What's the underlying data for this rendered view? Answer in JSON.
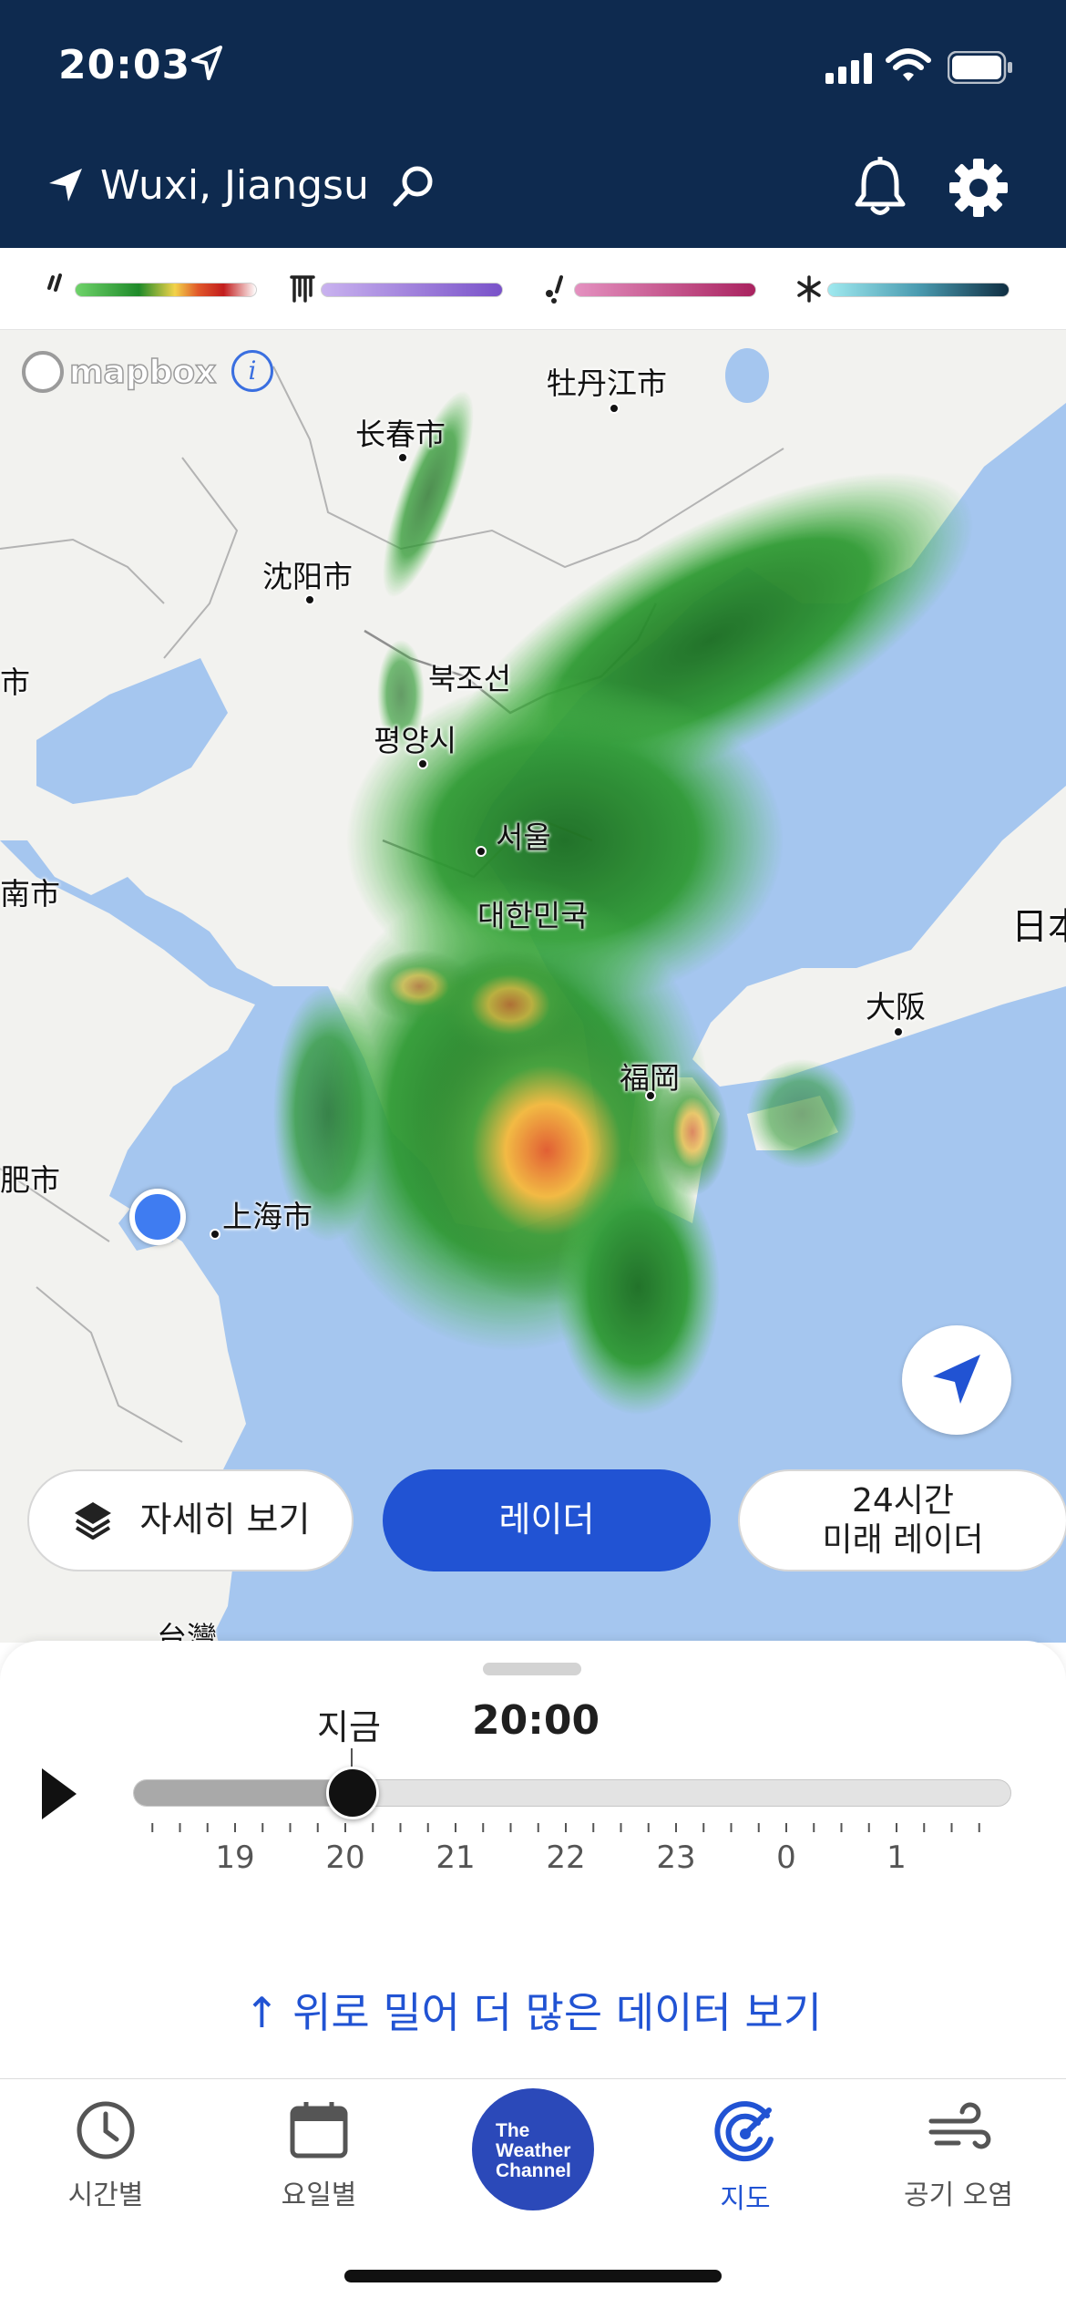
{
  "status_bar": {
    "time": "20:03"
  },
  "header": {
    "location": "Wuxi, Jiangsu"
  },
  "legend": {
    "items": [
      {
        "icon": "rain-icon",
        "gradient": [
          "#6fd36a",
          "#1f8a2a",
          "#f2d34a",
          "#e0572a",
          "#c21d1d",
          "#ffffff"
        ]
      },
      {
        "icon": "hail-icon",
        "gradient": [
          "#c9b2ef",
          "#7952c9"
        ]
      },
      {
        "icon": "sleet-icon",
        "gradient": [
          "#e491c0",
          "#a9225f"
        ]
      },
      {
        "icon": "snow-icon",
        "gradient": [
          "#9fe9ef",
          "#4a9bb0",
          "#0f2e42"
        ]
      }
    ]
  },
  "map": {
    "attribution": "mapbox",
    "info": "i",
    "labels": {
      "mudanjiang": "牡丹江市",
      "changchun": "长春市",
      "shenyang": "沈阳市",
      "north_korea": "북조선",
      "pyongyang": "평양시",
      "seoul": "서울",
      "south_korea": "대한민국",
      "jinan": "南市",
      "tianjin": "市",
      "japan": "日本",
      "osaka": "大阪",
      "fukuoka": "福岡",
      "hefei": "肥市",
      "shanghai": "上海市",
      "taiwan": "台灣"
    }
  },
  "controls": {
    "details_label": "자세히 보기",
    "radar_label": "레이더",
    "future_line1": "24시간",
    "future_line2": "미래 레이더"
  },
  "timeline": {
    "now_label": "지금",
    "current_time": "20:00",
    "progress_fraction": 0.25,
    "hours": [
      "19",
      "20",
      "21",
      "22",
      "23",
      "0",
      "1"
    ],
    "more_data": "↑ 위로 밀어 더 많은 데이터 보기"
  },
  "tabbar": {
    "tabs": [
      {
        "label": "시간별",
        "icon": "clock-icon"
      },
      {
        "label": "요일별",
        "icon": "calendar-icon"
      },
      {
        "label": "The Weather Channel",
        "icon": "weather-channel-logo"
      },
      {
        "label": "지도",
        "icon": "radar-icon",
        "active": true
      },
      {
        "label": "공기 오염",
        "icon": "wind-icon"
      }
    ],
    "logo_line1": "The",
    "logo_line2": "Weather",
    "logo_line3": "Channel"
  },
  "colors": {
    "header_bg": "#0e2a4f",
    "accent": "#2153d3",
    "sea": "#a5c6ef",
    "land": "#f2f2ef"
  }
}
